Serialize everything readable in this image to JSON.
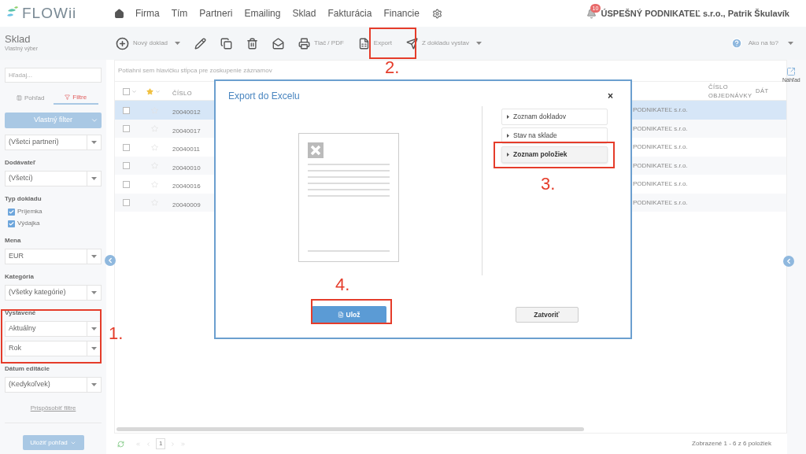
{
  "logo": {
    "text": "FLOWii"
  },
  "nav": {
    "items": [
      "Firma",
      "Tím",
      "Partneri",
      "Emailing",
      "Sklad",
      "Fakturácia",
      "Financie"
    ]
  },
  "user": {
    "badge": "10",
    "name": "ÚSPEŠNÝ PODNIKATEĽ s.r.o., Patrik Škulavík"
  },
  "page": {
    "title": "Sklad",
    "subtitle": "Vlastný výber"
  },
  "toolbar": {
    "items": [
      {
        "kind": "new",
        "label": "Nový doklad",
        "dropdown": true
      },
      {
        "kind": "edit",
        "dropdown": false
      },
      {
        "kind": "copy",
        "dropdown": false
      },
      {
        "kind": "delete",
        "dropdown": false
      },
      {
        "kind": "email",
        "dropdown": false
      },
      {
        "kind": "print",
        "label": "Tlač / PDF",
        "dropdown": false
      },
      {
        "kind": "export",
        "label": "Export",
        "dropdown": false
      },
      {
        "kind": "send",
        "label": "Z dokladu vystav",
        "dropdown": true
      }
    ],
    "help": {
      "label": "Ako na to?"
    }
  },
  "sidebar": {
    "search": {
      "placeholder": "Hľadaj..."
    },
    "tabs": [
      {
        "label": "Pohľad",
        "selected": false
      },
      {
        "label": "Filtre",
        "selected": true
      }
    ],
    "filter_button": "Vlastný filter",
    "filters": [
      {
        "kind": "select",
        "values": [
          "(Všetci partneri)"
        ]
      },
      {
        "kind": "select",
        "label": "Dodávateľ",
        "values": [
          "(Všetci)"
        ]
      },
      {
        "kind": "checks",
        "label": "Typ dokladu",
        "options": [
          {
            "label": "Príjemka",
            "checked": true
          },
          {
            "label": "Výdajka",
            "checked": true
          }
        ]
      },
      {
        "kind": "select",
        "label": "Mena",
        "values": [
          "EUR"
        ]
      },
      {
        "kind": "select",
        "label": "Kategória",
        "values": [
          "(Všetky kategórie)"
        ]
      },
      {
        "kind": "select",
        "label": "Vystavené",
        "values": [
          "Aktuálny",
          "Rok"
        ]
      },
      {
        "kind": "select",
        "label": "Dátum editácie",
        "values": [
          "(Kedykoľvek)"
        ]
      }
    ],
    "customize_link": "Prispôsobiť filtre",
    "save_button": "Uložiť pohľad"
  },
  "grid": {
    "group_hint": "Potiahni sem hlavičku stĺpca pre zoskupenie záznamov",
    "select_all": {
      "checked": false
    },
    "columns": [
      {
        "label": "ČÍSLO"
      },
      {
        "label": "ČÍSLO OBJEDNÁVKY"
      },
      {
        "label": "DÁT"
      }
    ],
    "rows": [
      {
        "number": "20040012",
        "partner": "PODNIKATEĽ s.r.o.",
        "selected": true,
        "checked": false,
        "starred": false
      },
      {
        "number": "20040017",
        "partner": "PODNIKATEĽ s.r.o.",
        "selected": false,
        "checked": false,
        "starred": false
      },
      {
        "number": "20040011",
        "partner": "PODNIKATEĽ s.r.o.",
        "selected": false,
        "checked": false,
        "starred": false
      },
      {
        "number": "20040010",
        "partner": "PODNIKATEĽ s.r.o.",
        "selected": false,
        "checked": false,
        "starred": false
      },
      {
        "number": "20040016",
        "partner": "PODNIKATEĽ s.r.o.",
        "selected": false,
        "checked": false,
        "starred": false
      },
      {
        "number": "20040009",
        "partner": "PODNIKATEĽ s.r.o.",
        "selected": false,
        "checked": false,
        "starred": false
      }
    ]
  },
  "footer": {
    "page": "1",
    "summary": "Zobrazené 1 - 6 z 6 položiek"
  },
  "preview": {
    "label": "Náhľad"
  },
  "dialog": {
    "title": "Export do Excelu",
    "close": "×",
    "options": [
      {
        "label": "Zoznam dokladov",
        "selected": false
      },
      {
        "label": "Stav na sklade",
        "selected": false
      },
      {
        "label": "Zoznam položiek",
        "selected": true
      }
    ],
    "save_button": "Ulož",
    "close_button": "Zatvoriť"
  },
  "annotations": [
    {
      "label": "1."
    },
    {
      "label": "2."
    },
    {
      "label": "3."
    },
    {
      "label": "4."
    }
  ]
}
